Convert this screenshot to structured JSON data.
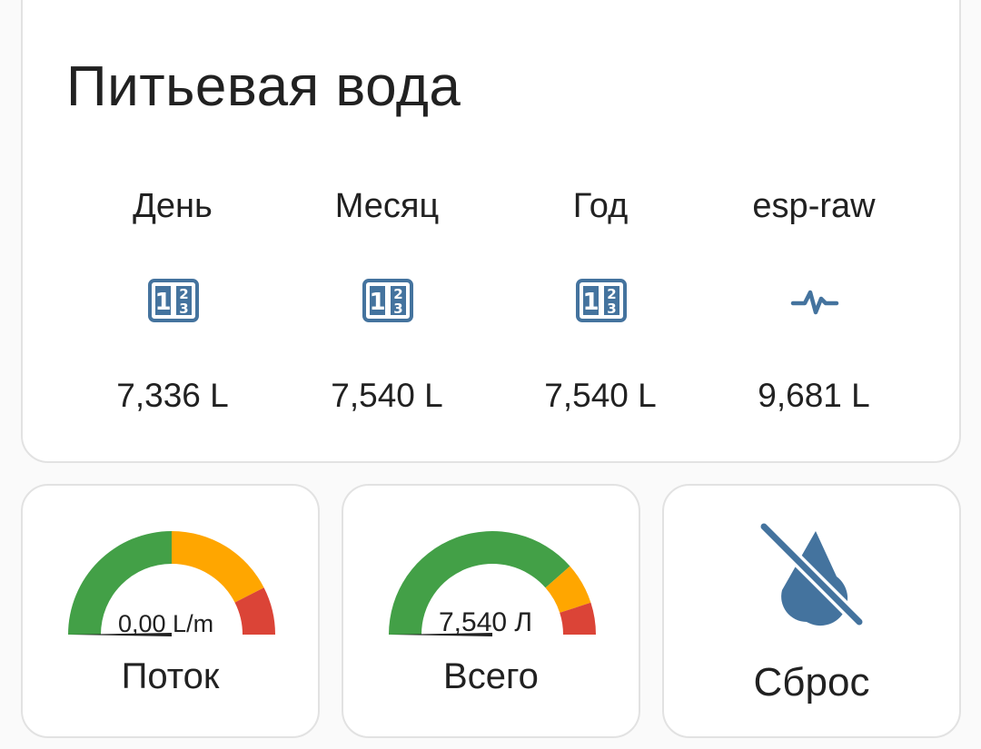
{
  "title": "Питьевая вода",
  "entities": [
    {
      "name": "День",
      "icon": "counter-icon",
      "value": "7,336 L"
    },
    {
      "name": "Месяц",
      "icon": "counter-icon",
      "value": "7,540 L"
    },
    {
      "name": "Год",
      "icon": "counter-icon",
      "value": "7,540 L"
    },
    {
      "name": "esp-raw",
      "icon": "pulse-icon",
      "value": "9,681 L"
    }
  ],
  "gauges": [
    {
      "name": "Поток",
      "value": "0,00 L/m",
      "level": 0.0,
      "severity": [
        0.5,
        0.85,
        1.0
      ]
    },
    {
      "name": "Всего",
      "value": "7,540 Л",
      "level": 0.0,
      "severity": [
        0.77,
        0.9,
        1.0
      ]
    }
  ],
  "button": {
    "name": "Сброс",
    "icon": "water-off-icon"
  },
  "colors": {
    "icon": "#44739e",
    "green": "#43a047",
    "yellow": "#ffa600",
    "red": "#db4437",
    "needle": "#212121"
  }
}
